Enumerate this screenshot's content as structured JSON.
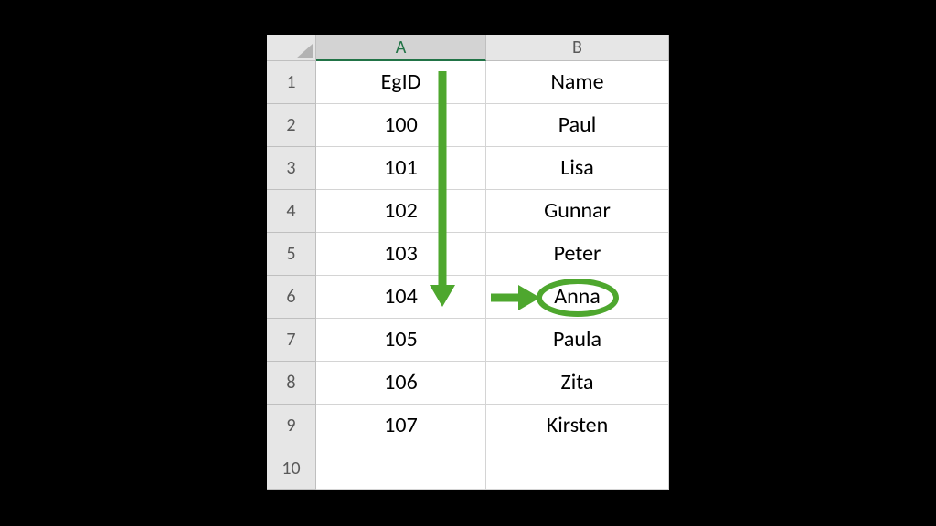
{
  "columns": [
    "A",
    "B"
  ],
  "selectedColumnIndex": 0,
  "rowNumbers": [
    "1",
    "2",
    "3",
    "4",
    "5",
    "6",
    "7",
    "8",
    "9",
    "10"
  ],
  "table": {
    "headerRow": {
      "a": "EgID",
      "b": "Name"
    },
    "rows": [
      {
        "a": "100",
        "b": "Paul"
      },
      {
        "a": "101",
        "b": "Lisa"
      },
      {
        "a": "102",
        "b": "Gunnar"
      },
      {
        "a": "103",
        "b": "Peter"
      },
      {
        "a": "104",
        "b": "Anna"
      },
      {
        "a": "105",
        "b": "Paula"
      },
      {
        "a": "106",
        "b": "Zita"
      },
      {
        "a": "107",
        "b": "Kirsten"
      }
    ]
  },
  "annotation": {
    "color": "#4ea72e",
    "highlightedCellValue": "Anna"
  }
}
